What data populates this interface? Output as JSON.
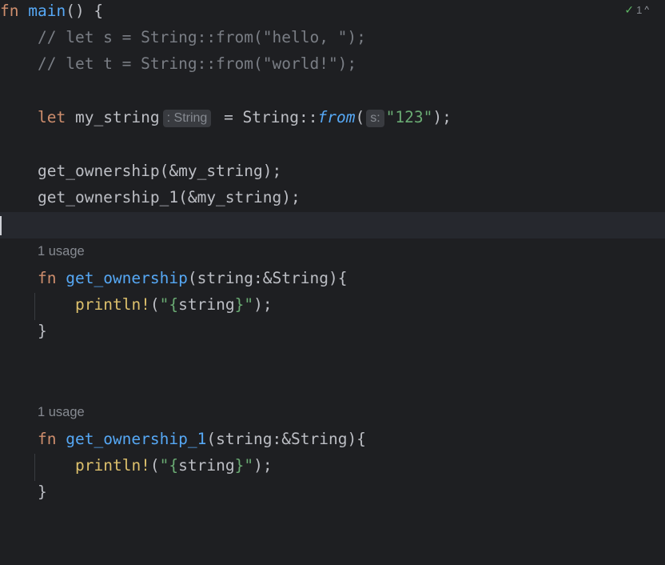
{
  "inspection": {
    "icon": "check-warning-icon",
    "count": "1",
    "chevron": "^"
  },
  "code": {
    "l1": {
      "kw": "fn",
      "name": "main",
      "rest": "() {"
    },
    "l2": {
      "comment": "// let s = String::from(\"hello, \");"
    },
    "l3": {
      "comment": "// let t = String::from(\"world!\");"
    },
    "l5": {
      "kw": "let",
      "var": " my_string",
      "type_hint": ": String",
      "eq": " = String::",
      "call": "from",
      "paren_open": "(",
      "param_hint": "s:",
      "str": "\"123\"",
      "end": ");"
    },
    "l7": {
      "text": "get_ownership(&my_string);"
    },
    "l8": {
      "text": "get_ownership_1(&my_string);"
    },
    "usage1": "1 usage",
    "f1": {
      "kw": "fn",
      "name": "get_ownership",
      "params": "(string:&String){"
    },
    "f1_body": {
      "macro": "println!",
      "open": "(",
      "q1": "\"",
      "b1": "{",
      "arg": "string",
      "b2": "}",
      "q2": "\"",
      "close": ");"
    },
    "f1_end": "}",
    "usage2": "1 usage",
    "f2": {
      "kw": "fn",
      "name": "get_ownership_1",
      "params": "(string:&String){"
    },
    "f2_body": {
      "macro": "println!",
      "open": "(",
      "q1": "\"",
      "b1": "{",
      "arg": "string",
      "b2": "}",
      "q2": "\"",
      "close": ");"
    },
    "f2_end": "}"
  }
}
